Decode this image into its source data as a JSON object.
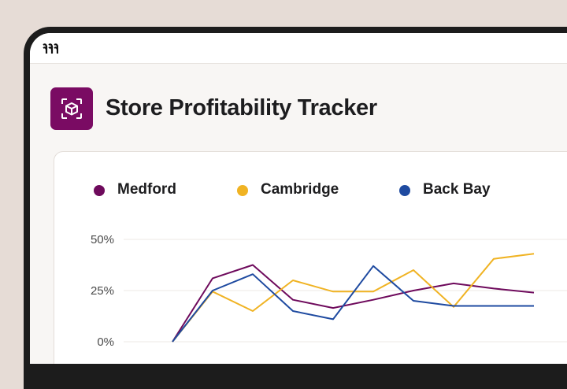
{
  "app": {
    "title": "Store Profitability Tracker",
    "logo_icon": "brand-logo-icon",
    "app_icon": "box-scan-icon",
    "accent_color": "#7a0b63"
  },
  "chart_data": {
    "type": "line",
    "title": "",
    "xlabel": "",
    "ylabel": "",
    "ylim": [
      0,
      50
    ],
    "yticks": [
      {
        "value": 0,
        "label": "0%"
      },
      {
        "value": 25,
        "label": "25%"
      },
      {
        "value": 50,
        "label": "50%"
      }
    ],
    "x": [
      1,
      2,
      3,
      4,
      5,
      6,
      7,
      8,
      9,
      10
    ],
    "grid": true,
    "legend_position": "top",
    "series": [
      {
        "name": "Medford",
        "color": "#6e0a5c",
        "values": [
          0,
          31,
          37.5,
          20.5,
          16.5,
          20.5,
          25,
          28.5,
          26,
          24
        ]
      },
      {
        "name": "Cambridge",
        "color": "#f0b323",
        "values": [
          0,
          24.5,
          15,
          30,
          24.5,
          24.5,
          35,
          17,
          40.5,
          43
        ]
      },
      {
        "name": "Back Bay",
        "color": "#1e4aa0",
        "values": [
          0,
          25,
          33,
          15,
          11,
          37,
          20,
          17.5,
          17.5,
          17.5
        ]
      }
    ]
  }
}
